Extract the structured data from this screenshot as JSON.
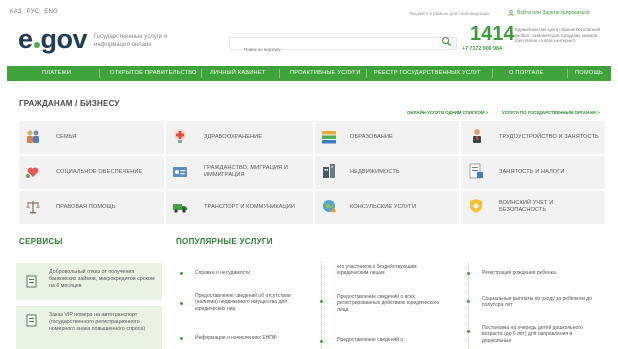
{
  "lang": [
    "КАЗ",
    "РУС",
    "ENG"
  ],
  "top": {
    "note": "Выдайте в рамках для слабовидящих",
    "login": "Войти или Зарегистрироваться"
  },
  "header": {
    "logo_left": "e",
    "logo_right": "gov",
    "logo_sub": "Государственные услуги и информация онлайн",
    "search_placeholder": "Поиск по порталу",
    "call_number": "1414",
    "call_phone": "+7 7172 906 984",
    "call_text": "Единый контакт-центр Звонок бесплатный (мобил. позвонит) для городских звонков (бесплатно со всего интернет)"
  },
  "nav": [
    "ПЛАТЕЖИ",
    "ОТКРЫТОЕ ПРАВИТЕЛЬСТВО",
    "ЛИЧНЫЙ КАБИНЕТ",
    "ПРОАКТИВНЫЕ УСЛУГИ",
    "РЕЕСТР ГОСУДАРСТВЕННЫХ УСЛУГ",
    "О ПОРТАЛЕ",
    "ПОМОЩЬ"
  ],
  "section": {
    "title": "ГРАЖДАНАМ / БИЗНЕСУ",
    "link1": "ОНЛАЙН-УСЛУГИ ОДНИМ СПИСКОМ >",
    "link2": "УСЛУГИ ПО ГОСУДАРСТВЕННЫМ ОРГАНАМ >"
  },
  "categories": [
    {
      "label": "СЕМЬЯ",
      "icon": "family-icon"
    },
    {
      "label": "ЗДРАВООХРАНЕНИЕ",
      "icon": "healthcare-icon"
    },
    {
      "label": "ОБРАЗОВАНИЕ",
      "icon": "education-icon"
    },
    {
      "label": "ТРУДОУСТРОЙСТВО И ЗАНЯТОСТЬ",
      "icon": "employment-icon"
    },
    {
      "label": "СОЦИАЛЬНОЕ ОБЕСПЕЧЕНИЕ",
      "icon": "social-icon"
    },
    {
      "label": "ГРАЖДАНСТВО, МИГРАЦИЯ И ИММИГРАЦИЯ",
      "icon": "migration-icon"
    },
    {
      "label": "НЕДВИЖИМОСТЬ",
      "icon": "realestate-icon"
    },
    {
      "label": "ЗАНЯТОСТЬ И НАЛОГИ",
      "icon": "taxes-icon"
    },
    {
      "label": "ПРАВОВАЯ ПОМОЩЬ",
      "icon": "legal-scales-icon"
    },
    {
      "label": "ТРАНСПОРТ И КОММУНИКАЦИИ",
      "icon": "truck-icon"
    },
    {
      "label": "КОНСУЛЬСКИЕ УСЛУГИ",
      "icon": "globe-icon"
    },
    {
      "label": "ВОИНСКИЙ УЧЕТ И БЕЗОПАСНОСТЬ",
      "icon": "shield-icon"
    }
  ],
  "services": {
    "title": "СЕРВИСЫ",
    "items": [
      "Добровольный отказ от получения банковских займов, микрокредитов сроком на 6 месяцев",
      "Заказ VIP номера на автотранспорт (государственного регистрационного номерного знака повышенного спроса)"
    ]
  },
  "popular": {
    "title": "ПОПУЛЯРНЫЕ УСЛУГИ",
    "col1": [
      "Справка о несудимости",
      "Предоставление сведений об отсутствии (наличии) недвижимого имущества для юридических лиц",
      "Информация о начислениях ЕНПФ"
    ],
    "col2": [
      "его участников к бездействующим юридическим лицам",
      "Предоставление сведений о всех регистрированных действиях юридического лица",
      "Предоставление сведений о"
    ],
    "col3": [
      "Регистрация рождения ребенка",
      "Социальные выплаты по уходу за ребенком до полутора лет",
      "Постановка на очередь детей дошкольного возраста (до 6 лет) для направления в дошкольные"
    ]
  },
  "colors": {
    "green": "#3ea33a",
    "dark": "#1c3d5a",
    "cell_bg": "#f2f2f2",
    "service_bg": "#e9f3e4"
  }
}
